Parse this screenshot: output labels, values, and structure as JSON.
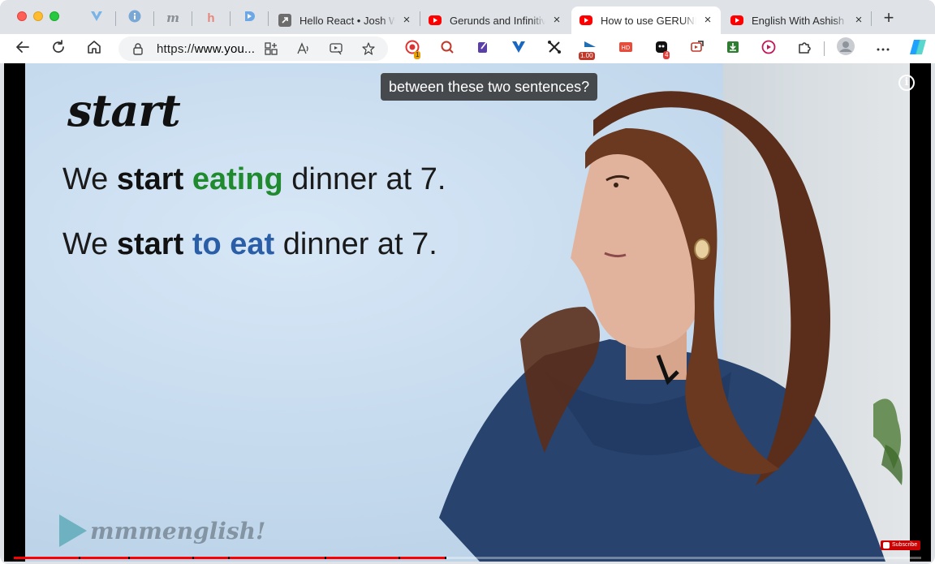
{
  "browser": {
    "tabs": [
      {
        "title": "Hello React • Josh W",
        "favicon": "link-arrow-icon",
        "active": false
      },
      {
        "title": "Gerunds and Infinitive",
        "favicon": "youtube-icon",
        "active": false
      },
      {
        "title": "How to use GERUNDS",
        "favicon": "youtube-icon",
        "active": true
      },
      {
        "title": "English With Ashish -",
        "favicon": "youtube-icon",
        "active": false
      }
    ],
    "pinned_tabs": [
      "vuetify-icon",
      "info-icon",
      "m-icon",
      "h-icon",
      "play-d-icon"
    ],
    "close_glyph": "×",
    "new_tab_glyph": "+",
    "address": {
      "prefix": "https://",
      "host": "www.you..."
    },
    "extension_badges": {
      "red_dot": "1",
      "playback_speed": "1.00",
      "counter": "4"
    },
    "colors": {
      "tab_strip": "#dfe3e8",
      "accent_red": "#ff0000"
    }
  },
  "video": {
    "lesson_word": "start",
    "sentence1": {
      "p1": "We ",
      "verb": "start",
      "space": " ",
      "form": "eating",
      "rest": " dinner at 7."
    },
    "sentence2": {
      "p1": "We ",
      "verb": "start",
      "space": " ",
      "form": "to eat",
      "rest": " dinner at 7."
    },
    "caption": "between these two sentences?",
    "info_glyph": "i",
    "watermark": "mmmenglish!",
    "subscribe_label": "Subscribe",
    "progress_fraction": 0.475,
    "chapter_fractions": [
      0.072,
      0.126,
      0.197,
      0.236,
      0.343,
      0.424,
      0.475
    ]
  }
}
